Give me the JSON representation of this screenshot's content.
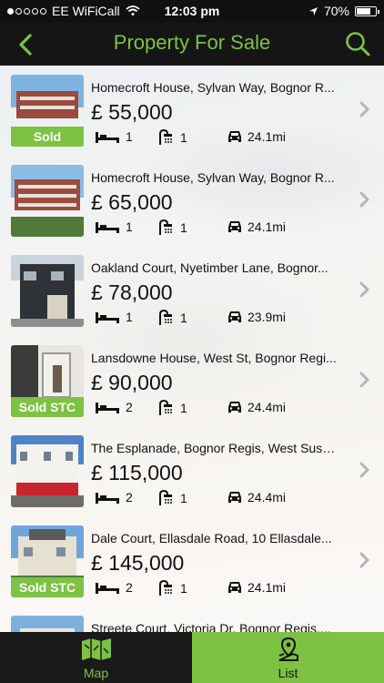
{
  "status_bar": {
    "carrier": "EE WiFiCall",
    "time": "12:03 pm",
    "battery": "70%"
  },
  "header": {
    "title": "Property For Sale"
  },
  "listings": [
    {
      "address": "Homecroft House, Sylvan Way, Bognor R...",
      "price": "£ 55,000",
      "beds": "1",
      "baths": "1",
      "distance": "24.1mi",
      "badge": "Sold"
    },
    {
      "address": "Homecroft House, Sylvan Way, Bognor R...",
      "price": "£ 65,000",
      "beds": "1",
      "baths": "1",
      "distance": "24.1mi",
      "badge": ""
    },
    {
      "address": "Oakland Court, Nyetimber Lane, Bognor...",
      "price": "£ 78,000",
      "beds": "1",
      "baths": "1",
      "distance": "23.9mi",
      "badge": ""
    },
    {
      "address": "Lansdowne House, West St, Bognor Regi...",
      "price": "£ 90,000",
      "beds": "2",
      "baths": "1",
      "distance": "24.4mi",
      "badge": "Sold STC"
    },
    {
      "address": "The Esplanade, Bognor Regis, West Suss...",
      "price": "£ 115,000",
      "beds": "2",
      "baths": "1",
      "distance": "24.4mi",
      "badge": ""
    },
    {
      "address": "Dale Court, Ellasdale Road, 10 Ellasdale...",
      "price": "£ 145,000",
      "beds": "2",
      "baths": "1",
      "distance": "24.1mi",
      "badge": "Sold STC"
    },
    {
      "address": "Streete Court, Victoria Dr, Bognor Regis,...",
      "price": "",
      "beds": "",
      "baths": "",
      "distance": "",
      "badge": ""
    }
  ],
  "tabs": [
    {
      "label": "Map",
      "icon": "map-icon",
      "active": false
    },
    {
      "label": "List",
      "icon": "map-pin-icon",
      "active": true
    }
  ],
  "colors": {
    "accent": "#7dc242",
    "bar": "#151515"
  }
}
